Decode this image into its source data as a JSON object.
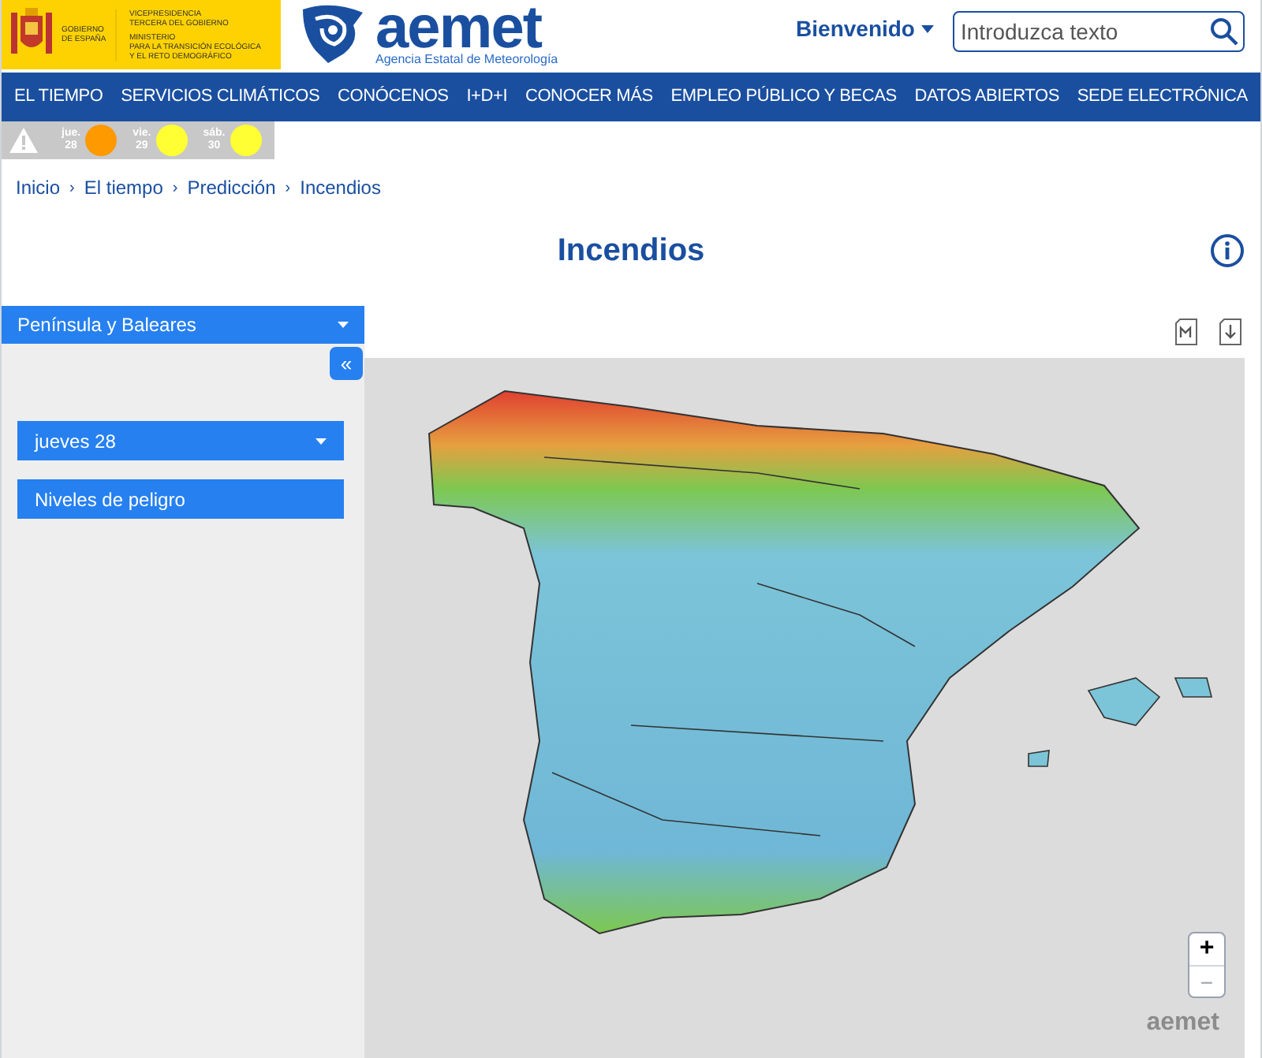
{
  "header": {
    "gov_logo": {
      "name": [
        "GOBIERNO",
        "DE ESPAÑA"
      ],
      "office": [
        "VICEPRESIDENCIA",
        "TERCERA DEL GOBIERNO"
      ],
      "ministry": [
        "MINISTERIO",
        "PARA LA TRANSICIÓN ECOLÓGICA",
        "Y EL RETO DEMOGRÁFICO"
      ]
    },
    "aemet_logo": {
      "wordmark": "aemet",
      "subtitle": "Agencia Estatal de Meteorología"
    },
    "user_menu": "Bienvenido",
    "search": {
      "placeholder": "Introduzca texto"
    }
  },
  "nav": [
    "EL TIEMPO",
    "SERVICIOS CLIMÁTICOS",
    "CONÓCENOS",
    "I+D+I",
    "CONOCER MÁS",
    "EMPLEO PÚBLICO Y BECAS",
    "DATOS ABIERTOS",
    "SEDE ELECTRÓNICA"
  ],
  "alerts": [
    {
      "day": "jue.",
      "date": "28",
      "color": "#ff9900"
    },
    {
      "day": "vie.",
      "date": "29",
      "color": "#ffff33"
    },
    {
      "day": "sáb.",
      "date": "30",
      "color": "#ffff33"
    }
  ],
  "breadcrumb": {
    "separator": "›",
    "items": [
      "Inicio",
      "El tiempo",
      "Predicción",
      "Incendios"
    ]
  },
  "title": "Incendios",
  "sidebar": {
    "region": "Península y Baleares",
    "collapse": "«",
    "day": "jueves 28",
    "levels_button": "Niveles de peligro"
  },
  "map": {
    "zoom_in": "+",
    "zoom_out": "−",
    "logo": "aemet"
  }
}
